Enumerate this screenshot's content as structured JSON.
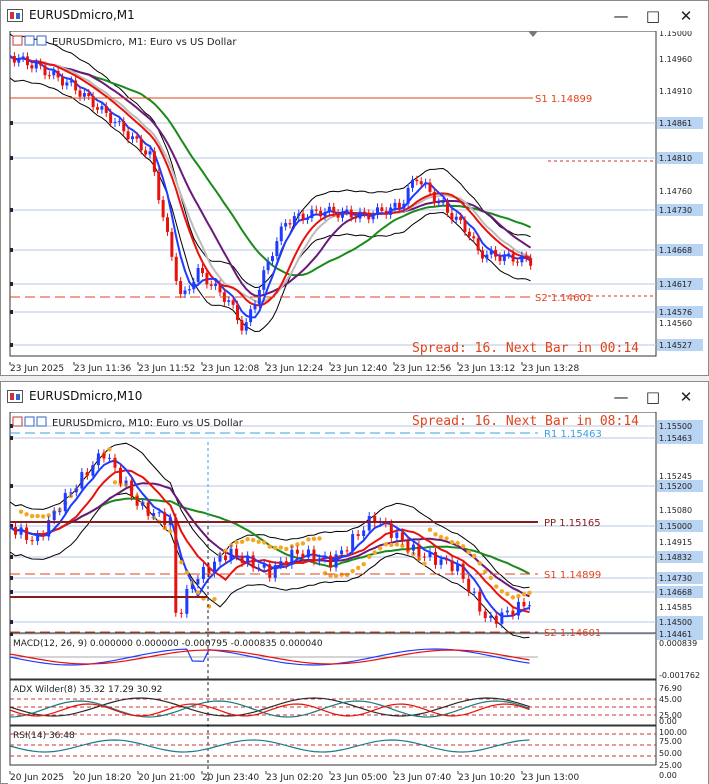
{
  "windows": [
    {
      "title": "EURUSDmicro,M1",
      "header": "EURUSDmicro, M1:  Euro vs US Dollar",
      "info": "Spread: 16. Next Bar in 00:14",
      "prices": [
        "1.15000",
        "1.14960",
        "1.14910",
        "1.14861",
        "1.14810",
        "1.14760",
        "1.14730",
        "1.14668",
        "1.14617",
        "1.14576",
        "1.14560",
        "1.14527"
      ],
      "pivots": [
        {
          "label": "S1 1.14899",
          "color": "#e0431b"
        },
        {
          "label": "S2 1.14601",
          "color": "#e0431b"
        }
      ],
      "times": [
        "23 Jun 2025",
        "23 Jun 11:36",
        "23 Jun 11:52",
        "23 Jun 12:08",
        "23 Jun 12:24",
        "23 Jun 12:40",
        "23 Jun 12:56",
        "23 Jun 13:12",
        "23 Jun 13:28"
      ]
    },
    {
      "title": "EURUSDmicro,M10",
      "header": "EURUSDmicro, M10:  Euro vs US Dollar",
      "info": "Spread: 16. Next Bar in 08:14",
      "prices": [
        "1.15500",
        "1.15463",
        "1.15245",
        "1.15200",
        "1.15080",
        "1.15000",
        "1.14915",
        "1.14832",
        "1.14730",
        "1.14668",
        "1.14585",
        "1.14500",
        "1.14461"
      ],
      "pivots": [
        {
          "label": "R1 1.15463",
          "color": "#3aa0e6"
        },
        {
          "label": "PP 1.15165",
          "color": "#8b1a1a"
        },
        {
          "label": "S1 1.14899",
          "color": "#e0431b"
        },
        {
          "label": "S2 1.14601",
          "color": "#e0431b"
        }
      ],
      "macd": {
        "label": "MACD(12, 26, 9)  0.000000  0.000000  -0.000795  -0.000835  0.000040",
        "scale": [
          "0.000839",
          "-0.001762"
        ]
      },
      "adx": {
        "label": "ADX Wilder(8)  35.32  17.29  30.92",
        "scale": [
          "76.90",
          "45.00",
          "25.00",
          "0.00"
        ]
      },
      "rsi": {
        "label": "RSI(14)  36.48",
        "scale": [
          "100.00",
          "75.00",
          "50.00",
          "25.00",
          "0.00"
        ]
      },
      "times": [
        "20 Jun 2025",
        "20 Jun 18:20",
        "20 Jun 21:00",
        "20 Jun 23:40",
        "23 Jun 02:20",
        "23 Jun 05:00",
        "23 Jun 07:40",
        "23 Jun 10:20",
        "23 Jun 13:00"
      ]
    }
  ],
  "window_buttons": {
    "minimize": "—",
    "maximize": "□",
    "close": "✕"
  },
  "colors": {
    "bull": "#1e3cff",
    "bear": "#e8120c",
    "grid": "#b7c6e6",
    "pivot": "#e0431b",
    "ma_green": "#1a8a1a",
    "ma_purple": "#6a1a7a",
    "bands": "#000000",
    "sar": "#f5a623"
  }
}
